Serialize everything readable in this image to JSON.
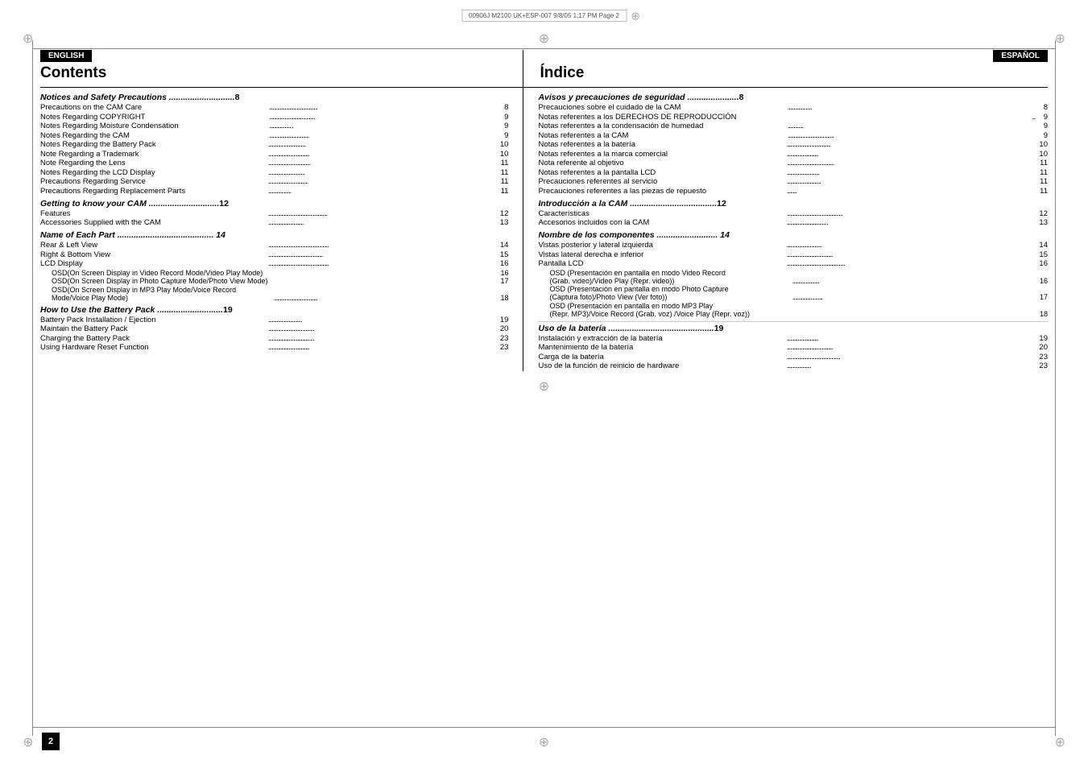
{
  "page": {
    "number": "2",
    "print_ref": "00906J M2100 UK+ESP-007   9/8/05  1:17 PM   Page  2"
  },
  "left": {
    "lang_label": "ENGLISH",
    "title": "Contents",
    "sections": [
      {
        "type": "italic_section",
        "label": "Notices and Safety Precautions ............................",
        "page": "8"
      },
      {
        "type": "entry",
        "label": "Precautions on the CAM Care",
        "dots": true,
        "page": "8"
      },
      {
        "type": "entry",
        "label": "Notes Regarding COPYRIGHT",
        "dots": true,
        "page": "9"
      },
      {
        "type": "entry",
        "label": "Notes Regarding Moisture Condensation",
        "dots": true,
        "page": "9"
      },
      {
        "type": "entry",
        "label": "Notes Regarding the CAM",
        "dots": true,
        "page": "9"
      },
      {
        "type": "entry",
        "label": "Notes Regarding the Battery Pack",
        "dots": true,
        "page": "10"
      },
      {
        "type": "entry",
        "label": "Note Regarding a Trademark",
        "dots": true,
        "page": "10"
      },
      {
        "type": "entry",
        "label": "Note Regarding the Lens",
        "dots": true,
        "page": "11"
      },
      {
        "type": "entry",
        "label": "Notes Regarding the LCD Display",
        "dots": true,
        "page": "11"
      },
      {
        "type": "entry",
        "label": "Precautions Regarding Service",
        "dots": true,
        "page": "11"
      },
      {
        "type": "entry",
        "label": "Precautions Regarding Replacement Parts",
        "dots": true,
        "page": "11"
      },
      {
        "type": "italic_section",
        "label": "Getting to know your CAM ..............................",
        "page": "12"
      },
      {
        "type": "entry",
        "label": "Features",
        "dots": true,
        "page": "12"
      },
      {
        "type": "entry",
        "label": "Accessories Supplied with the CAM",
        "dots": true,
        "page": "13"
      },
      {
        "type": "italic_section",
        "label": "Name of Each Part .......................................  14",
        "page": ""
      },
      {
        "type": "entry",
        "label": "Rear & Left View",
        "dots": true,
        "page": "14"
      },
      {
        "type": "entry",
        "label": "Right & Bottom View",
        "dots": true,
        "page": "15"
      },
      {
        "type": "entry",
        "label": "LCD Display",
        "dots": true,
        "page": "16"
      },
      {
        "type": "entry_indented",
        "label": "OSD(On Screen Display in Video Record Mode/Video Play Mode)",
        "dots": true,
        "page": "16"
      },
      {
        "type": "entry_indented",
        "label": "OSD(On Screen Display in Photo Capture Mode/Photo View Mode)",
        "dots": true,
        "page": "17"
      },
      {
        "type": "entry_indented",
        "label": "OSD(On Screen Display in MP3 Play Mode/Voice Record",
        "dots": false,
        "page": ""
      },
      {
        "type": "entry_indented2",
        "label": "Mode/Voice Play Mode)",
        "dots": true,
        "page": "18"
      },
      {
        "type": "italic_section",
        "label": "How to Use the Battery Pack ............................",
        "page": "19"
      },
      {
        "type": "entry",
        "label": "Battery Pack Installation / Ejection",
        "dots": true,
        "page": "19"
      },
      {
        "type": "entry",
        "label": "Maintain the Battery Pack",
        "dots": true,
        "page": "20"
      },
      {
        "type": "entry",
        "label": "Charging the Battery Pack",
        "dots": true,
        "page": "23"
      },
      {
        "type": "entry",
        "label": "Using Hardware Reset Function",
        "dots": true,
        "page": "23"
      }
    ]
  },
  "right": {
    "lang_label": "ESPAÑOL",
    "title": "Índice",
    "sections": [
      {
        "type": "italic_section",
        "label": "Avisos y precauciones de seguridad ......................",
        "page": "8"
      },
      {
        "type": "entry",
        "label": "Precauciones sobre el cuidado de la CAM",
        "dots": true,
        "page": "8"
      },
      {
        "type": "entry",
        "label": "Notas referentes a los DERECHOS DE REPRODUCCIÓN",
        "dots": true,
        "page": "9"
      },
      {
        "type": "entry",
        "label": "Notas referentes a la condensación de humedad",
        "dots": true,
        "page": "9"
      },
      {
        "type": "entry",
        "label": "Notas referentes a la CAM",
        "dots": true,
        "page": "9"
      },
      {
        "type": "entry",
        "label": "Notas referentes a la batería",
        "dots": true,
        "page": "10"
      },
      {
        "type": "entry",
        "label": "Notas referentes a la marca comercial",
        "dots": true,
        "page": "10"
      },
      {
        "type": "entry",
        "label": "Nota referente al objetivo",
        "dots": true,
        "page": "11"
      },
      {
        "type": "entry",
        "label": "Notas referentes a la pantalla LCD",
        "dots": true,
        "page": "11"
      },
      {
        "type": "entry",
        "label": "Precauciones referentes al servicio",
        "dots": true,
        "page": "11"
      },
      {
        "type": "entry",
        "label": "Precauciones referentes a las piezas de repuesto",
        "dots": true,
        "page": "11"
      },
      {
        "type": "italic_section",
        "label": "Introducción a la CAM .....................................",
        "page": "12"
      },
      {
        "type": "entry",
        "label": "Características",
        "dots": true,
        "page": "12"
      },
      {
        "type": "entry",
        "label": "Accesorios incluidos con la CAM",
        "dots": true,
        "page": "13"
      },
      {
        "type": "italic_section",
        "label": "Nombre de los componentes ..........................  14",
        "page": ""
      },
      {
        "type": "entry",
        "label": "Vistas posterior y lateral izquierda",
        "dots": true,
        "page": "14"
      },
      {
        "type": "entry",
        "label": "Vistas lateral derecha e inferior",
        "dots": true,
        "page": "15"
      },
      {
        "type": "entry",
        "label": "Pantalla LCD",
        "dots": true,
        "page": "16"
      },
      {
        "type": "entry_indented",
        "label": "OSD (Presentación en pantalla en modo Video Record",
        "dots": false,
        "page": ""
      },
      {
        "type": "entry_indented2",
        "label": "(Grab. video)/Video Play (Repr. video))",
        "dots": true,
        "page": "16"
      },
      {
        "type": "entry_indented",
        "label": "OSD (Presentación en pantalla en modo Photo Capture",
        "dots": false,
        "page": ""
      },
      {
        "type": "entry_indented2",
        "label": "(Captura foto)/Photo View (Ver foto))",
        "dots": true,
        "page": "17"
      },
      {
        "type": "entry_indented",
        "label": "OSD (Presentación en pantalla en modo MP3 Play",
        "dots": false,
        "page": ""
      },
      {
        "type": "entry_indented2",
        "label": "(Repr. MP3)/Voice Record (Grab. voz) /Voice Play (Repr. voz))",
        "dots": true,
        "page": "18"
      },
      {
        "type": "italic_section",
        "label": "Uso de la batería .............................................",
        "page": "19"
      },
      {
        "type": "entry",
        "label": "Instalación y extracción de la batería",
        "dots": true,
        "page": "19"
      },
      {
        "type": "entry",
        "label": "Mantenimiento de la batería",
        "dots": true,
        "page": "20"
      },
      {
        "type": "entry",
        "label": "Carga de la batería",
        "dots": true,
        "page": "23"
      },
      {
        "type": "entry",
        "label": "Uso de la función de reinicio de hardware",
        "dots": true,
        "page": "23"
      }
    ]
  }
}
